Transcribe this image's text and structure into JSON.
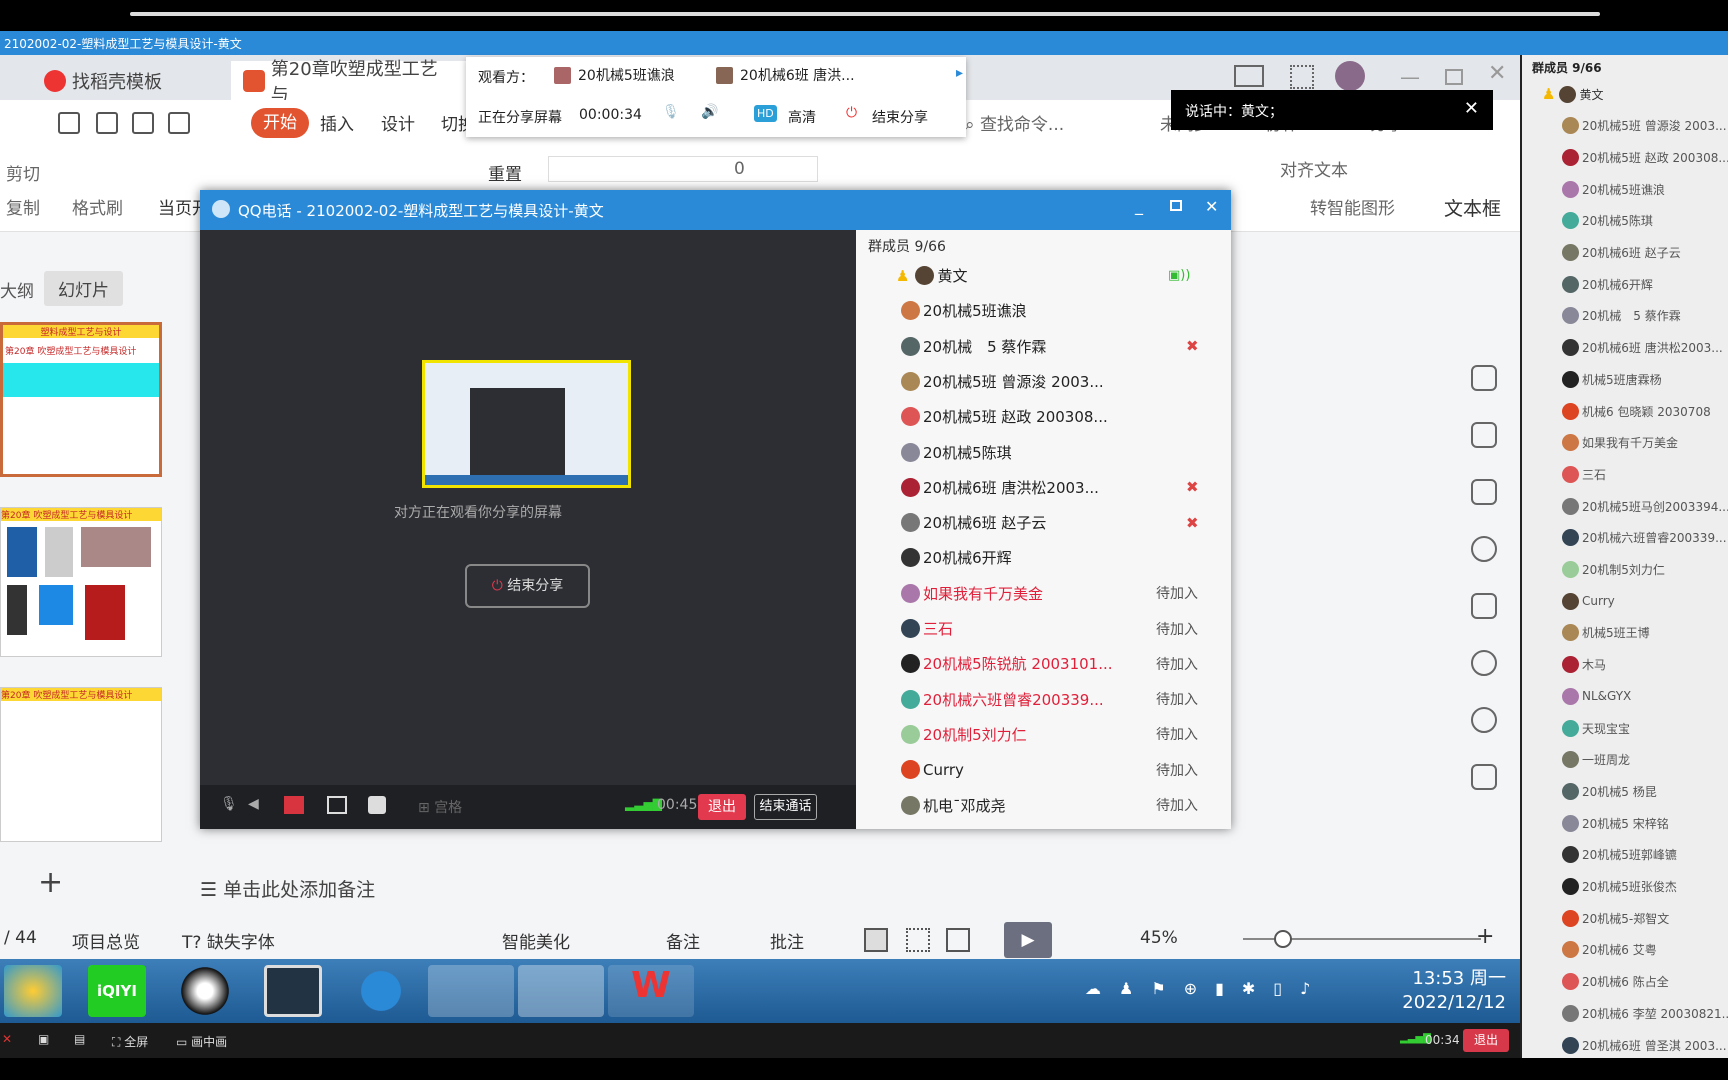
{
  "window_title": "2102002-02-塑料成型工艺与模具设计-黄文",
  "wps": {
    "tabs": [
      {
        "label": "找稻壳模板",
        "color": "#e33"
      },
      {
        "label": "第20章吹塑成型工艺与",
        "color": "#e2542f"
      }
    ],
    "menu": {
      "start": "开始",
      "items": [
        "插入",
        "设计",
        "切换"
      ],
      "search": "查找命令...",
      "sync": "未同步",
      "collab": "协作",
      "share": "分享"
    },
    "ribbon": {
      "cut": "剪切",
      "copy": "复制",
      "format_painter": "格式刷",
      "from_current": "当页开",
      "reset": "重置",
      "font_size": "0",
      "align_text": "对齐文本",
      "smart_art": "转智能图形",
      "textbox": "文本框"
    },
    "panel_tabs": [
      "大纲",
      "幻灯片"
    ],
    "slides": [
      {
        "title": "塑料成型工艺与设计",
        "subtitle": "第20章 吹塑成型工艺与模具设计"
      },
      {
        "subtitle": "第20章 吹塑成型工艺与模具设计"
      },
      {
        "subtitle": "第20章 吹塑成型工艺与模具设计"
      }
    ],
    "notes_placeholder": "单击此处添加备注",
    "status": {
      "page": "/ 44",
      "overview": "项目总览",
      "missing_font": "缺失字体",
      "beautify": "智能美化",
      "notes": "备注",
      "comment": "批注",
      "zoom": "45%"
    }
  },
  "share_popup": {
    "viewers_label": "观看方：",
    "viewers": [
      "20机械5班谯浪",
      "20机械6班 唐洪..."
    ],
    "sharing_label": "正在分享屏幕",
    "sharing_time": "00:00:34",
    "hd": "HD",
    "hd_label": "高清",
    "end_share": "结束分享"
  },
  "speaking": {
    "label": "说话中：黄文；"
  },
  "qq_call": {
    "title": "QQ电话 - 2102002-02-塑料成型工艺与模具设计-黄文",
    "watching_text": "对方正在观看你分享的屏幕",
    "end_share": "结束分享",
    "grid": "宫格",
    "timer": "00:45",
    "exit": "退出",
    "end_call": "结束通话",
    "member_header": "群成员 9/66",
    "members": [
      {
        "name": "黄文",
        "status": "speaking"
      },
      {
        "name": "20机械5班谯浪"
      },
      {
        "name": "20机械　5 蔡作霖",
        "status": "muted"
      },
      {
        "name": "20机械5班 曾源浚 2003..."
      },
      {
        "name": "20机械5班 赵政 200308..."
      },
      {
        "name": "20机械5陈琪"
      },
      {
        "name": "20机械6班 唐洪松2003...",
        "status": "muted"
      },
      {
        "name": "20机械6班 赵子云",
        "status": "muted"
      },
      {
        "name": "20机械6开辉"
      },
      {
        "name": "如果我有千万美金",
        "join": "待加入",
        "red": true
      },
      {
        "name": "三石",
        "join": "待加入",
        "red": true
      },
      {
        "name": "20机械5陈锐航 2003101...",
        "join": "待加入",
        "red": true
      },
      {
        "name": "20机械六班曾睿200339...",
        "join": "待加入",
        "red": true
      },
      {
        "name": "20机制5刘力仁",
        "join": "待加入",
        "red": true
      },
      {
        "name": "Curry",
        "join": "待加入"
      },
      {
        "name": "机电ˉ邓成尧",
        "join": "待加入"
      }
    ]
  },
  "side_members": {
    "header": "群成员 9/66",
    "names": [
      "黄文",
      "20机械5班 曾源浚 2003...",
      "20机械5班 赵政 200308...",
      "20机械5班谯浪",
      "20机械5陈琪",
      "20机械6班 赵子云",
      "20机械6开辉",
      "20机械　5 蔡作霖",
      "20机械6班 唐洪松2003...",
      "机械5班唐霖杨",
      "机械6 包晓颖 2030708",
      "如果我有千万美金",
      "三石",
      "20机械5班马创2003394...",
      "20机械六班曾睿200339...",
      "20机制5刘力仁",
      "Curry",
      "机械5班王博",
      "木马",
      "NL&GYX",
      "天现宝宝",
      "一班周龙",
      "20机械5 杨昆",
      "20机械5 宋梓铭",
      "20机械5班郭峰镳",
      "20机械5班张俊杰",
      "20机械5-郑智文",
      "20机械6 艾粤",
      "20机械6 陈占全",
      "20机械6 李堃 20030821...",
      "20机械6班 曾圣淇 2003..."
    ]
  },
  "taskbar": {
    "apps": [
      "app-launcher",
      "iqiyi",
      "qq",
      "screen-tool",
      "sogou",
      "file-explorer",
      "qq-call",
      "wps"
    ],
    "iqiyi_label": "iQIYI",
    "time": "13:53 周一",
    "date": "2022/12/12"
  },
  "call_bar": {
    "fullscreen": "全屏",
    "pip": "画中画",
    "timer": "00:34",
    "exit": "退出"
  }
}
